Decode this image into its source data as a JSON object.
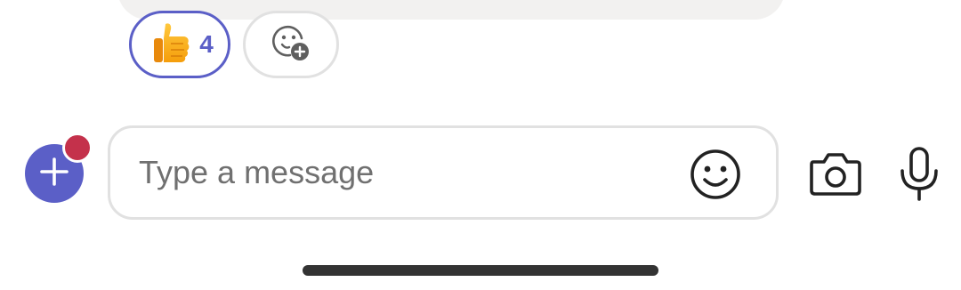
{
  "reactions": {
    "like": {
      "icon": "thumbs-up-icon",
      "count": "4"
    },
    "add": {
      "icon": "add-reaction-icon"
    }
  },
  "composer": {
    "placeholder": "Type a message",
    "add_button_icon": "plus-icon",
    "emoji_icon": "smiley-icon",
    "camera_icon": "camera-icon",
    "mic_icon": "microphone-icon"
  },
  "colors": {
    "accent": "#5b5fc7",
    "notification": "#c4314b",
    "bubble": "#f2f1f0",
    "border": "#e1e1e1",
    "placeholder_text": "#707070"
  }
}
